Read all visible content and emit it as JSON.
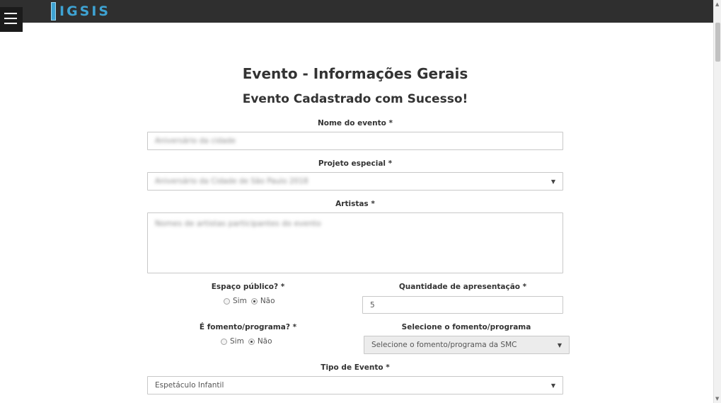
{
  "app": {
    "logo": "IGSIS"
  },
  "page": {
    "title": "Evento - Informações Gerais",
    "subtitle": "Evento Cadastrado com Sucesso!"
  },
  "form": {
    "event_name": {
      "label": "Nome do evento *",
      "value": "Aniversário da cidade"
    },
    "special_project": {
      "label": "Projeto especial *",
      "value": "Aniversário da Cidade de São Paulo 2018"
    },
    "artists": {
      "label": "Artistas *",
      "value": "Nomes de artistas participantes do evento"
    },
    "public_space": {
      "label": "Espaço público? *",
      "options": [
        "Sim",
        "Não"
      ],
      "selected": "Não"
    },
    "presentation_count": {
      "label": "Quantidade de apresentação *",
      "value": "5"
    },
    "is_fomento": {
      "label": "É fomento/programa? *",
      "options": [
        "Sim",
        "Não"
      ],
      "selected": "Não"
    },
    "fomento_select": {
      "label": "Selecione o fomento/programa",
      "value": "Selecione o fomento/programa da SMC"
    },
    "event_type": {
      "label": "Tipo de Evento *",
      "value": "Espetáculo Infantil"
    }
  }
}
